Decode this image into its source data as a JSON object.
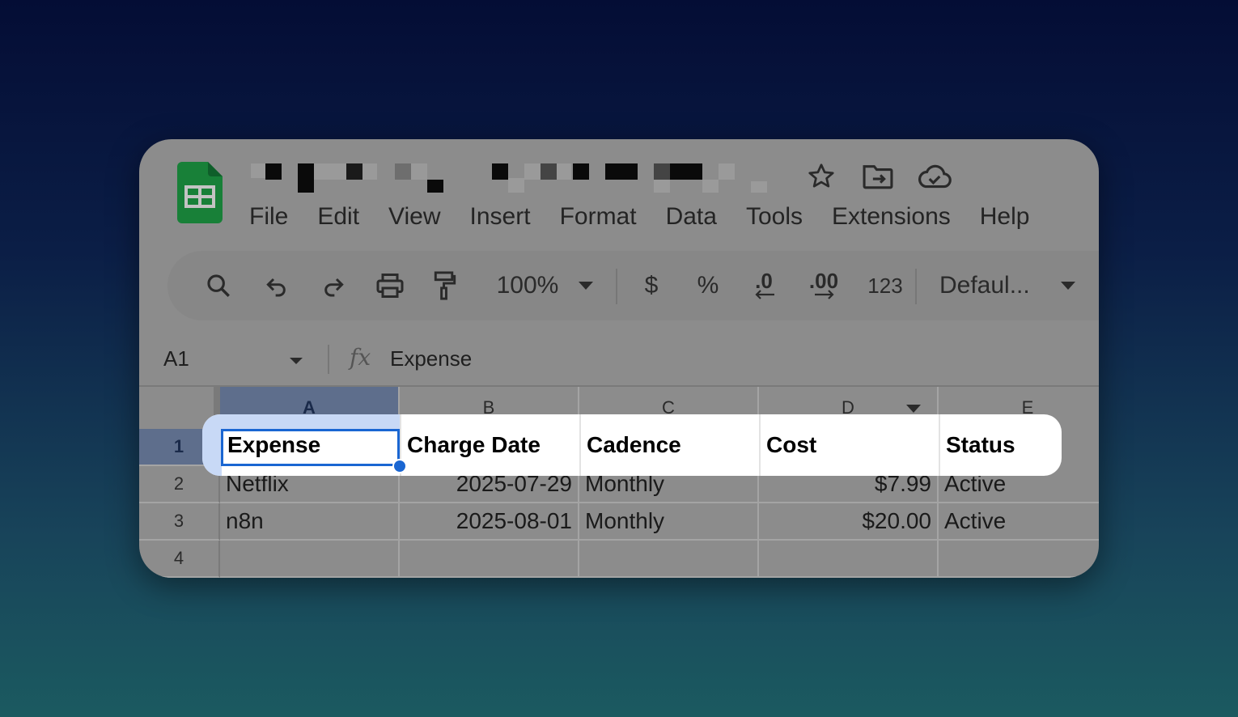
{
  "app": {
    "menu": [
      "File",
      "Edit",
      "View",
      "Insert",
      "Format",
      "Data",
      "Tools",
      "Extensions",
      "Help"
    ],
    "title_icons": [
      "star-icon",
      "move-to-folder-icon",
      "cloud-saved-icon"
    ]
  },
  "toolbar": {
    "zoom": "100%",
    "currency": "$",
    "percent": "%",
    "decrease_decimal": ".0",
    "increase_decimal": ".00",
    "number_format": "123",
    "font": "Defaul..."
  },
  "formula_bar": {
    "cell_ref": "A1",
    "fx": "fx",
    "value": "Expense"
  },
  "sheet": {
    "columns": [
      "A",
      "B",
      "C",
      "D",
      "E"
    ],
    "row_numbers": [
      "1",
      "2",
      "3",
      "4"
    ],
    "header": [
      "Expense",
      "Charge Date",
      "Cadence",
      "Cost",
      "Status"
    ],
    "rows": [
      [
        "Netflix",
        "2025-07-29",
        "Monthly",
        "$7.99",
        "Active"
      ],
      [
        "n8n",
        "2025-08-01",
        "Monthly",
        "$20.00",
        "Active"
      ],
      [
        "",
        "",
        "",
        "",
        ""
      ]
    ]
  },
  "colors": {
    "selection": "#1a66d2",
    "sheets_green": "#188038",
    "highlight": "#ffffff"
  }
}
